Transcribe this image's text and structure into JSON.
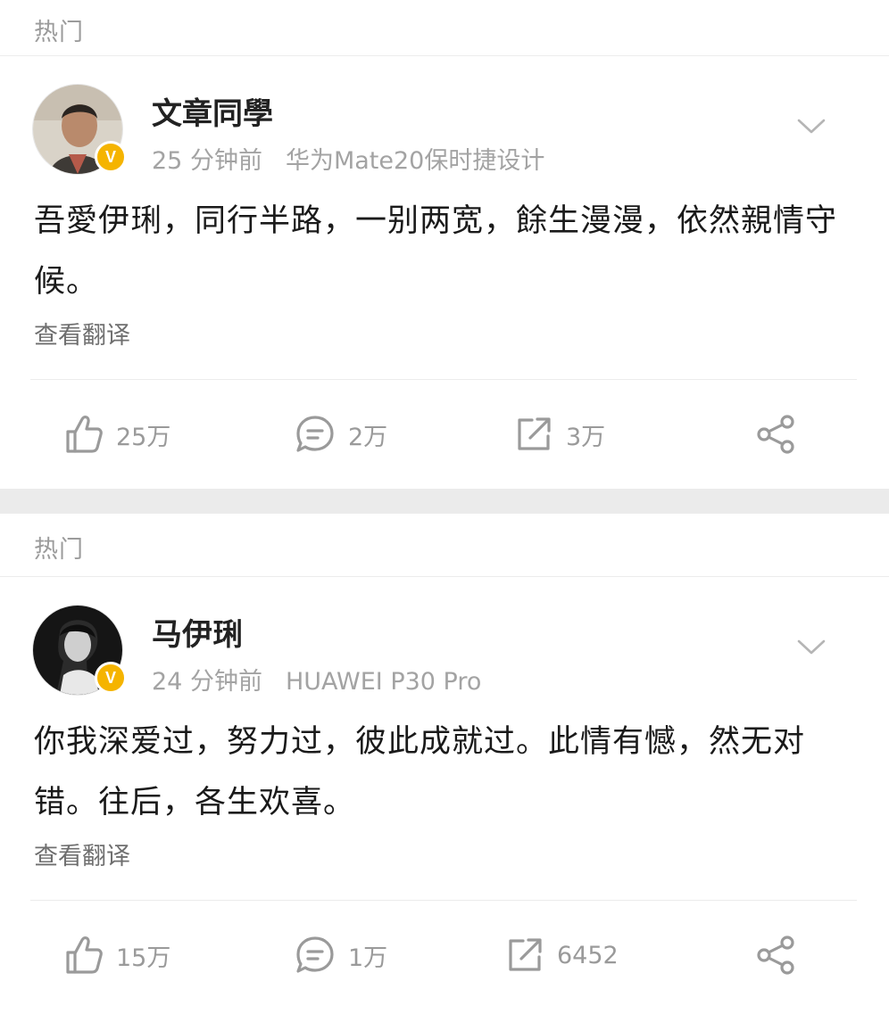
{
  "posts": [
    {
      "section_label": "热门",
      "username": "文章同學",
      "time": "25 分钟前",
      "device": "华为Mate20保时捷设计",
      "text": "吾愛伊琍，同行半路，一别两宽，餘生漫漫，依然親情守候。",
      "translate_label": "查看翻译",
      "likes": "25万",
      "comments": "2万",
      "reposts": "3万",
      "badge": "V"
    },
    {
      "section_label": "热门",
      "username": "马伊琍",
      "time": "24 分钟前",
      "device": "HUAWEI P30 Pro",
      "text": "你我深爱过，努力过，彼此成就过。此情有憾，然无对错。往后，各生欢喜。",
      "translate_label": "查看翻译",
      "likes": "15万",
      "comments": "1万",
      "reposts": "6452",
      "badge": "V"
    }
  ],
  "colors": {
    "badge": "#f5b400",
    "muted_text": "#a3a3a3",
    "section_gap": "#ebebeb"
  }
}
